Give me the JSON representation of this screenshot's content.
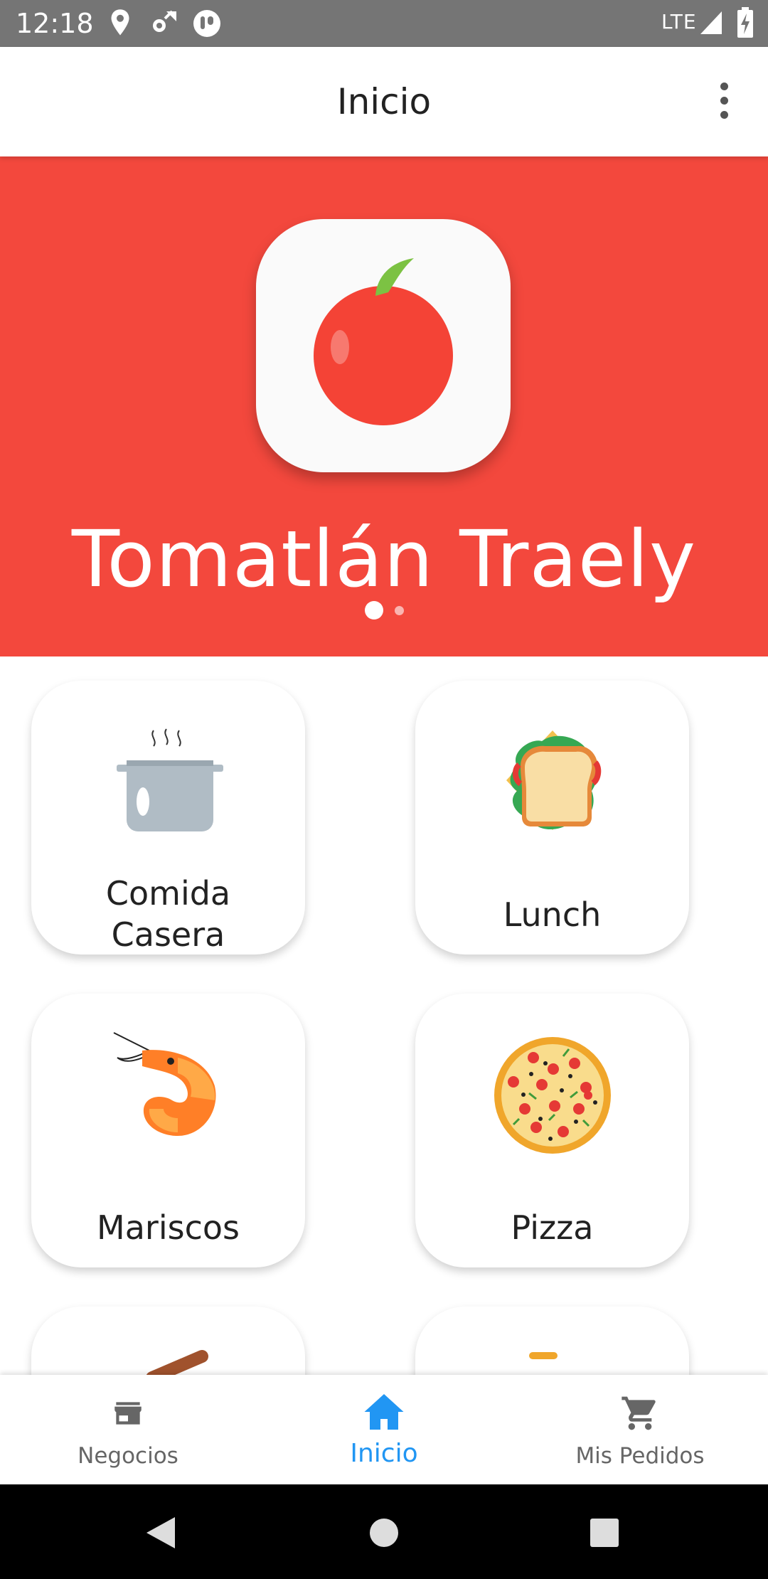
{
  "status_bar": {
    "time": "12:18",
    "network": "LTE",
    "icons": [
      "location-icon",
      "sync-settings-icon",
      "app-notification-icon",
      "signal-icon",
      "battery-charging-icon"
    ]
  },
  "app_bar": {
    "title": "Inicio",
    "menu_icon": "more-vert-icon"
  },
  "banner": {
    "brand_name": "Tomatlán Traely",
    "background_color": "#f3483d",
    "carousel": {
      "current": 1,
      "total": 2
    }
  },
  "categories": [
    {
      "label": "Comida Casera",
      "icon": "cooking-pot-icon"
    },
    {
      "label": "Lunch",
      "icon": "sandwich-icon"
    },
    {
      "label": "Mariscos",
      "icon": "shrimp-icon"
    },
    {
      "label": "Pizza",
      "icon": "pizza-icon"
    }
  ],
  "bottom_nav": {
    "items": [
      {
        "label": "Negocios",
        "icon": "store-icon",
        "active": false
      },
      {
        "label": "Inicio",
        "icon": "home-icon",
        "active": true
      },
      {
        "label": "Mis Pedidos",
        "icon": "cart-icon",
        "active": false
      }
    ],
    "active_color": "#2196f3"
  },
  "system_nav": [
    "back-icon",
    "home-circle-icon",
    "recents-icon"
  ]
}
